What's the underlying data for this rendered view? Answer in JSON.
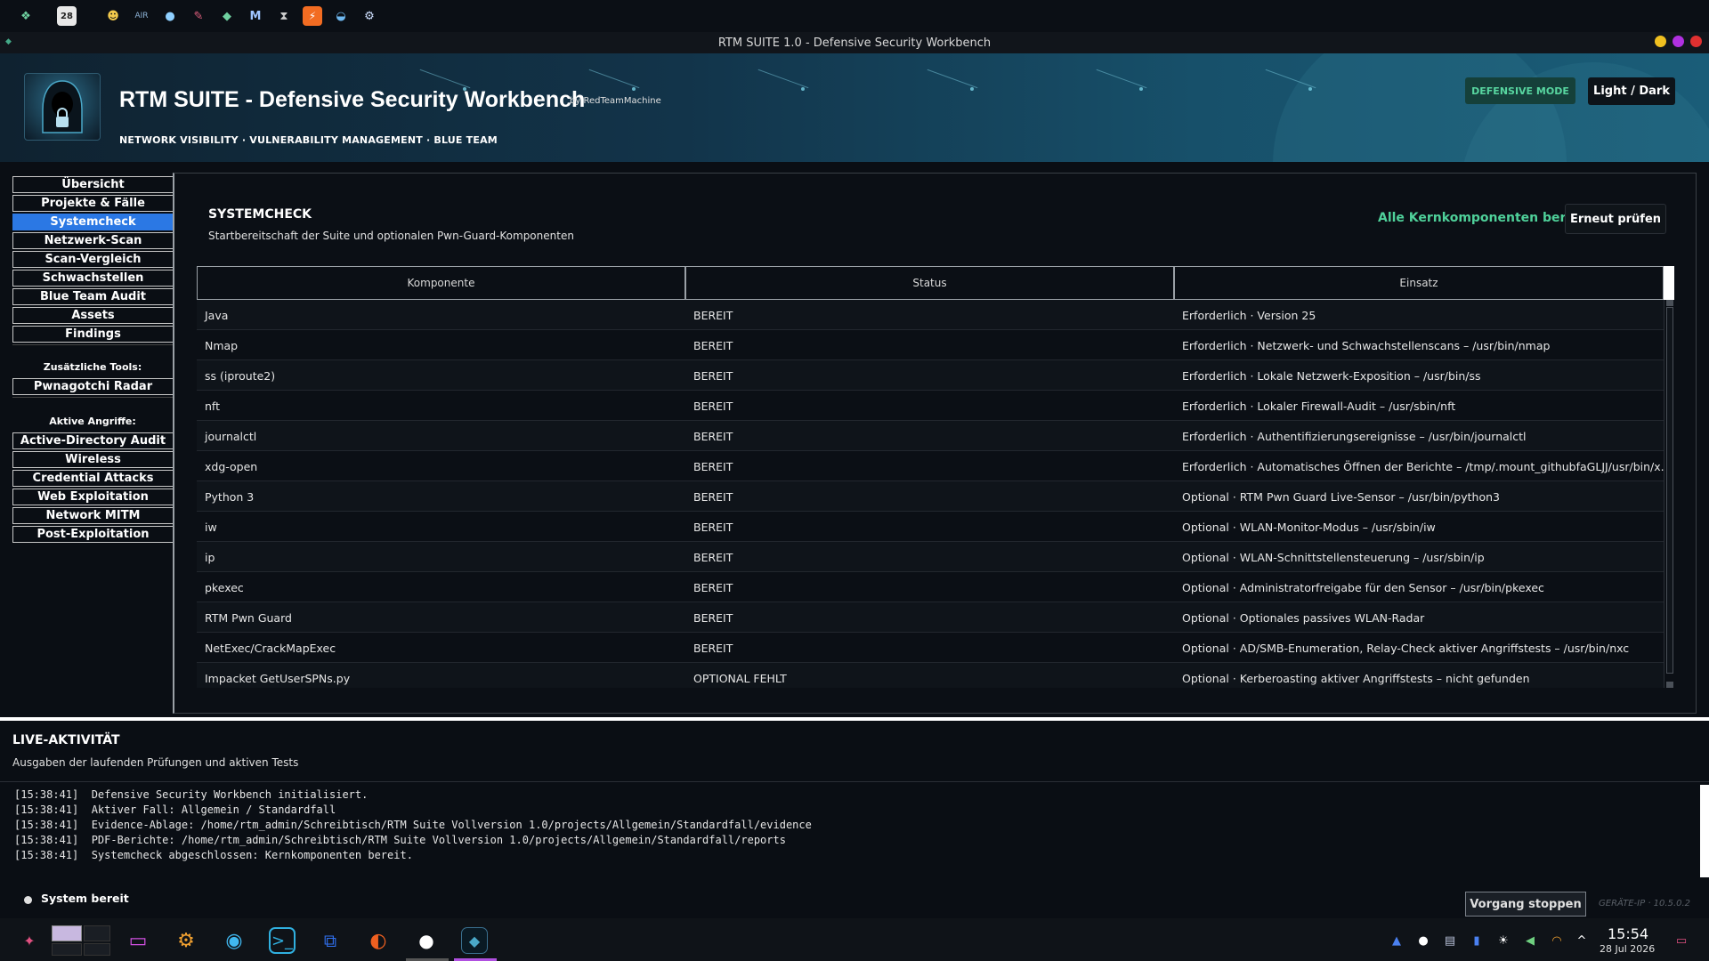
{
  "window_title": "RTM SUITE 1.0 - Defensive Security Workbench",
  "header": {
    "title": "RTM SUITE - Defensive Security Workbench",
    "by": "by RedTeamMachine",
    "subtitle": "NETWORK VISIBILITY  ·  VULNERABILITY MANAGEMENT  ·  BLUE TEAM",
    "mode_badge": "DEFENSIVE MODE",
    "theme_button": "Light / Dark"
  },
  "sidebar": {
    "items": [
      {
        "label": "Übersicht"
      },
      {
        "label": "Projekte & Fälle"
      },
      {
        "label": "Systemcheck",
        "active": true
      },
      {
        "label": "Netzwerk-Scan"
      },
      {
        "label": "Scan-Vergleich"
      },
      {
        "label": "Schwachstellen"
      },
      {
        "label": "Blue Team Audit"
      },
      {
        "label": "Assets"
      },
      {
        "label": "Findings"
      }
    ],
    "section_tools": "Zusätzliche Tools:",
    "tools": [
      {
        "label": "Pwnagotchi Radar"
      }
    ],
    "section_attacks": "Aktive Angriffe:",
    "attacks": [
      {
        "label": "Active-Directory Audit"
      },
      {
        "label": "Wireless"
      },
      {
        "label": "Credential Attacks"
      },
      {
        "label": "Web Exploitation"
      },
      {
        "label": "Network MITM"
      },
      {
        "label": "Post-Exploitation"
      }
    ]
  },
  "main": {
    "title": "SYSTEMCHECK",
    "description": "Startbereitschaft der Suite und optionalen Pwn-Guard-Komponenten",
    "status": "Alle Kernkomponenten bereit",
    "recheck_button": "Erneut prüfen",
    "columns": [
      "Komponente",
      "Status",
      "Einsatz"
    ],
    "rows": [
      [
        "Java",
        "BEREIT",
        "Erforderlich · Version 25"
      ],
      [
        "Nmap",
        "BEREIT",
        "Erforderlich · Netzwerk- und Schwachstellenscans – /usr/bin/nmap"
      ],
      [
        "ss (iproute2)",
        "BEREIT",
        "Erforderlich · Lokale Netzwerk-Exposition – /usr/bin/ss"
      ],
      [
        "nft",
        "BEREIT",
        "Erforderlich · Lokaler Firewall-Audit – /usr/sbin/nft"
      ],
      [
        "journalctl",
        "BEREIT",
        "Erforderlich · Authentifizierungsereignisse – /usr/bin/journalctl"
      ],
      [
        "xdg-open",
        "BEREIT",
        "Erforderlich · Automatisches Öffnen der Berichte – /tmp/.mount_githubfaGLJJ/usr/bin/x..."
      ],
      [
        "Python 3",
        "BEREIT",
        "Optional · RTM Pwn Guard Live-Sensor – /usr/bin/python3"
      ],
      [
        "iw",
        "BEREIT",
        "Optional · WLAN-Monitor-Modus – /usr/sbin/iw"
      ],
      [
        "ip",
        "BEREIT",
        "Optional · WLAN-Schnittstellensteuerung – /usr/sbin/ip"
      ],
      [
        "pkexec",
        "BEREIT",
        "Optional · Administratorfreigabe für den Sensor – /usr/bin/pkexec"
      ],
      [
        "RTM Pwn Guard",
        "BEREIT",
        "Optional · Optionales passives WLAN-Radar"
      ],
      [
        "NetExec/CrackMapExec",
        "BEREIT",
        "Optional · AD/SMB-Enumeration, Relay-Check aktiver Angriffstests – /usr/bin/nxc"
      ],
      [
        "Impacket GetUserSPNs.py",
        "OPTIONAL FEHLT",
        "Optional · Kerberoasting aktiver Angriffstests – nicht gefunden"
      ]
    ]
  },
  "live": {
    "title": "LIVE-AKTIVITÄT",
    "description": "Ausgaben der laufenden Prüfungen und aktiven Tests",
    "log": [
      "[15:38:41]  Defensive Security Workbench initialisiert.",
      "[15:38:41]  Aktiver Fall: Allgemein / Standardfall",
      "[15:38:41]  Evidence-Ablage: /home/rtm_admin/Schreibtisch/RTM Suite Vollversion 1.0/projects/Allgemein/Standardfall/evidence",
      "[15:38:41]  PDF-Berichte: /home/rtm_admin/Schreibtisch/RTM Suite Vollversion 1.0/projects/Allgemein/Standardfall/reports",
      "[15:38:41]  Systemcheck abgeschlossen: Kernkomponenten bereit."
    ],
    "status": "System bereit",
    "stop_button": "Vorgang stoppen",
    "device_ip": "GERÄTE-IP · 10.5.0.2"
  },
  "topbar_calendar_day": "28",
  "clock": {
    "time": "15:54",
    "date": "28 Jul 2026"
  },
  "colors": {
    "accent": "#2b78e4",
    "ready": "#4fd19a",
    "badge_bg": "#15403a"
  }
}
